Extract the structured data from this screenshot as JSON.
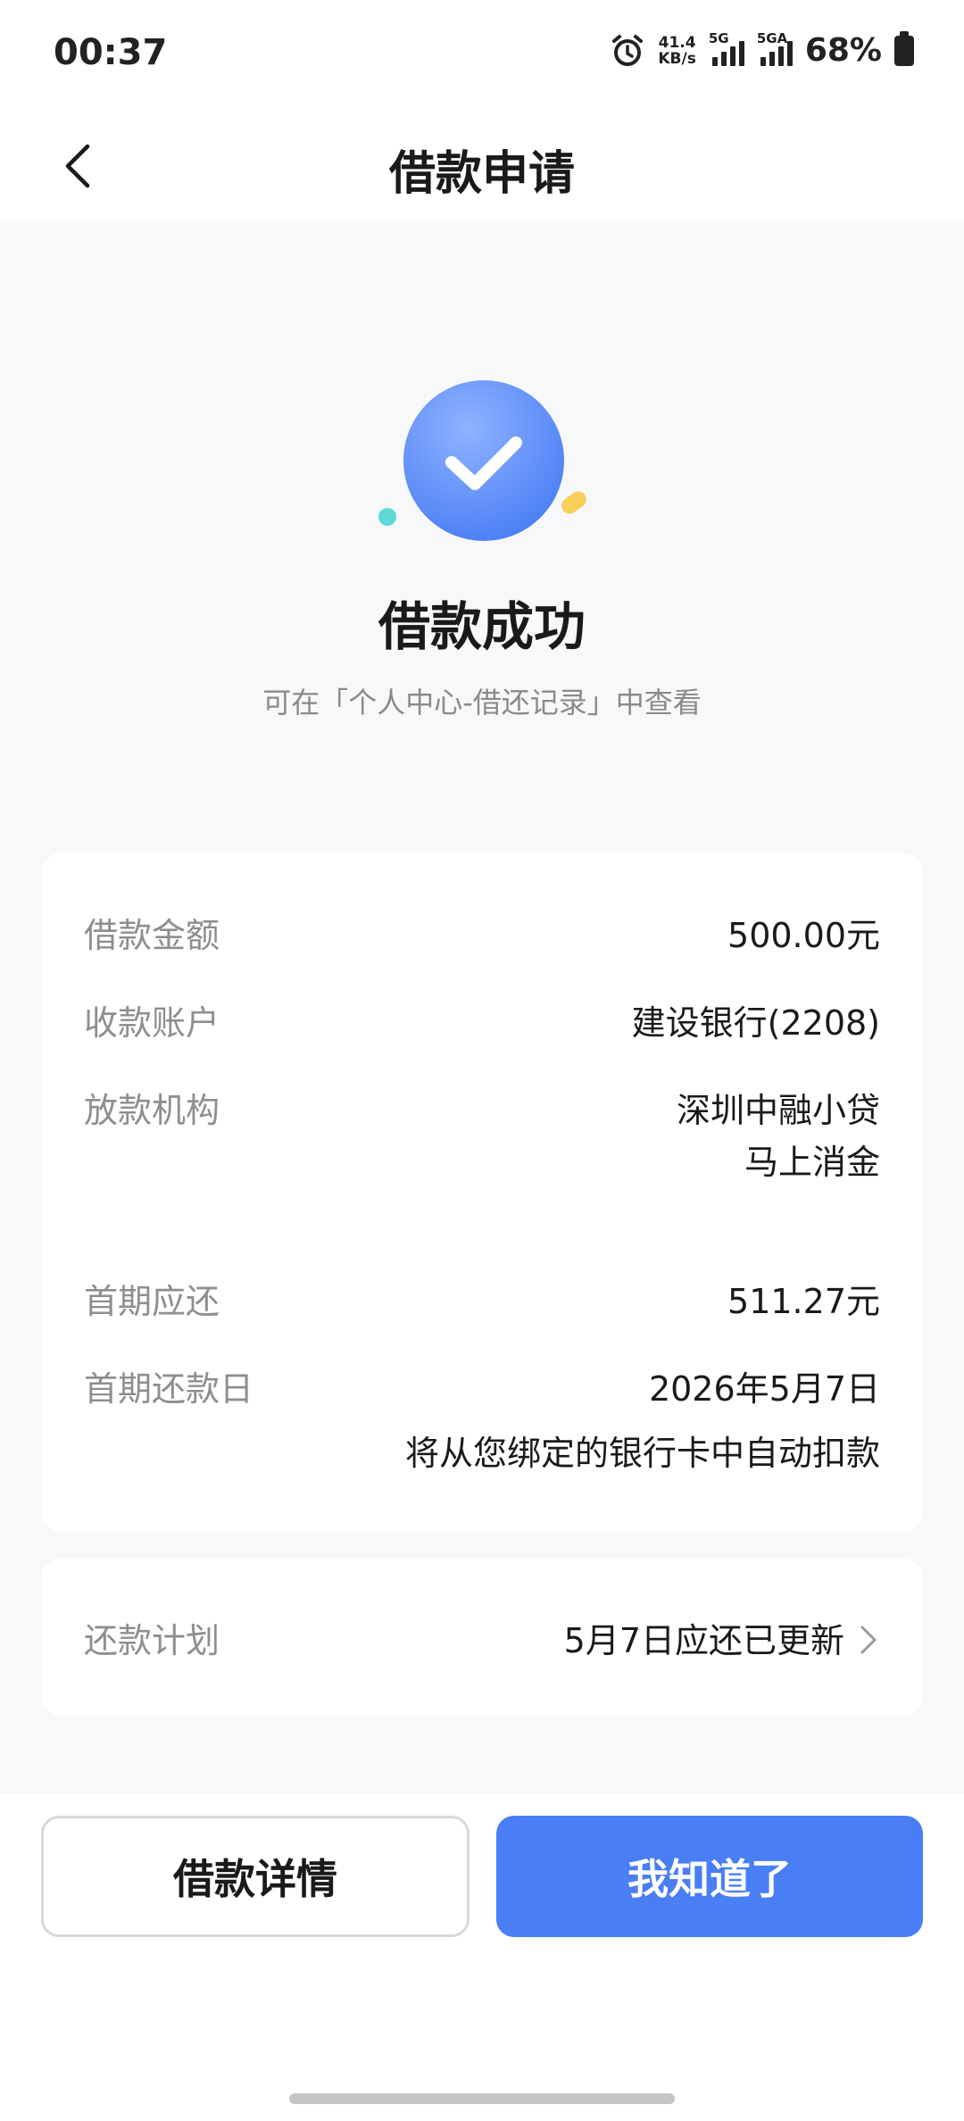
{
  "status_bar": {
    "time": "00:37",
    "net_speed_value": "41.4",
    "net_speed_unit": "KB/s",
    "sim1_label": "5G",
    "sim2_label": "5GA",
    "battery_percent": "68%",
    "icons": [
      "alarm-icon",
      "signal-icon",
      "battery-icon"
    ]
  },
  "header": {
    "title": "借款申请",
    "back_icon": "chevron-left-icon"
  },
  "result": {
    "title": "借款成功",
    "subtitle": "可在「个人中心-借还记录」中查看",
    "icon": "check-circle-icon",
    "accent_color": "#4a7ef5"
  },
  "details": {
    "rows": [
      {
        "label": "借款金额",
        "value": "500.00元"
      },
      {
        "label": "收款账户",
        "value": "建设银行(2208)"
      },
      {
        "label": "放款机构",
        "value_lines": [
          "深圳中融小贷",
          "马上消金"
        ]
      },
      {
        "label": "首期应还",
        "value": "511.27元"
      },
      {
        "label": "首期还款日",
        "value": "2026年5月7日",
        "note": "将从您绑定的银行卡中自动扣款"
      }
    ]
  },
  "plan": {
    "label": "还款计划",
    "value": "5月7日应还已更新"
  },
  "buttons": {
    "details_label": "借款详情",
    "confirm_label": "我知道了"
  }
}
